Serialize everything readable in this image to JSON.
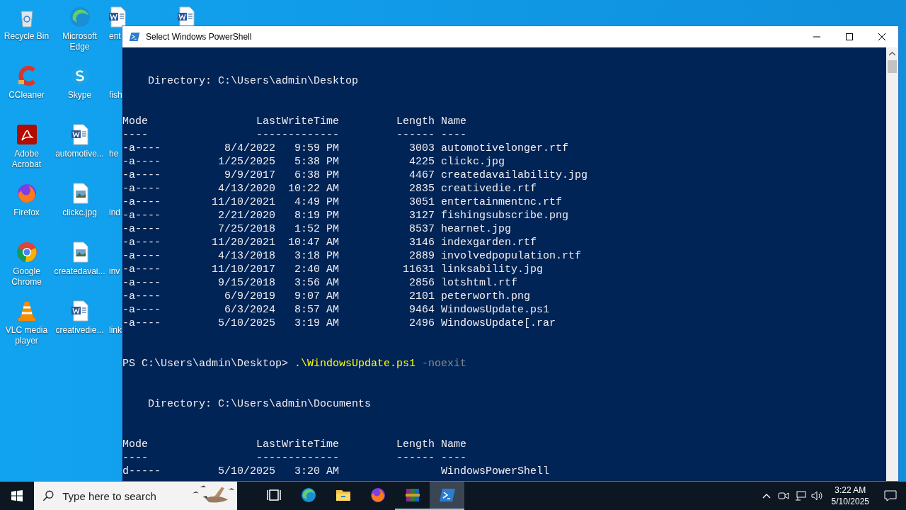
{
  "desktop_columns": [
    [
      {
        "kind": "bin",
        "label": "Recycle Bin"
      },
      {
        "kind": "ccleaner",
        "label": "CCleaner"
      },
      {
        "kind": "acrobat",
        "label": "Adobe Acrobat"
      },
      {
        "kind": "firefox",
        "label": "Firefox"
      },
      {
        "kind": "chrome",
        "label": "Google Chrome"
      },
      {
        "kind": "vlc",
        "label": "VLC media player"
      }
    ],
    [
      {
        "kind": "edge",
        "label": "Microsoft Edge"
      },
      {
        "kind": "skype",
        "label": "Skype"
      },
      {
        "kind": "word",
        "label": "automotive..."
      },
      {
        "kind": "image",
        "label": "clickc.jpg"
      },
      {
        "kind": "image",
        "label": "createdavai..."
      },
      {
        "kind": "word",
        "label": "creativedie..."
      }
    ],
    [
      {
        "kind": "word",
        "label": "ent"
      },
      {
        "kind": "hidden",
        "label": "fish"
      },
      {
        "kind": "hidden",
        "label": "he"
      },
      {
        "kind": "hidden",
        "label": "ind"
      },
      {
        "kind": "hidden",
        "label": "inv"
      },
      {
        "kind": "hidden",
        "label": "link"
      }
    ],
    [
      {
        "kind": "word"
      }
    ]
  ],
  "window": {
    "title": "Select Windows PowerShell"
  },
  "console": [
    {
      "kind": "blank"
    },
    {
      "kind": "blank"
    },
    {
      "kind": "directory",
      "text": "Directory: C:\\Users\\admin\\Desktop"
    },
    {
      "kind": "blank"
    },
    {
      "kind": "blank"
    },
    {
      "kind": "header",
      "mode": "Mode",
      "time": "LastWriteTime",
      "length": "Length",
      "name": "Name"
    },
    {
      "kind": "header",
      "mode": "----",
      "time": "-------------",
      "length": "------",
      "name": "----"
    },
    {
      "kind": "row",
      "mode": "-a----",
      "date": "8/4/2022",
      "time": "9:59 PM",
      "length": "3003",
      "name": "automotivelonger.rtf"
    },
    {
      "kind": "row",
      "mode": "-a----",
      "date": "1/25/2025",
      "time": "5:38 PM",
      "length": "4225",
      "name": "clickc.jpg"
    },
    {
      "kind": "row",
      "mode": "-a----",
      "date": "9/9/2017",
      "time": "6:38 PM",
      "length": "4467",
      "name": "createdavailability.jpg"
    },
    {
      "kind": "row",
      "mode": "-a----",
      "date": "4/13/2020",
      "time": "10:22 AM",
      "length": "2835",
      "name": "creativedie.rtf"
    },
    {
      "kind": "row",
      "mode": "-a----",
      "date": "11/10/2021",
      "time": "4:49 PM",
      "length": "3051",
      "name": "entertainmentnc.rtf"
    },
    {
      "kind": "row",
      "mode": "-a----",
      "date": "2/21/2020",
      "time": "8:19 PM",
      "length": "3127",
      "name": "fishingsubscribe.png"
    },
    {
      "kind": "row",
      "mode": "-a----",
      "date": "7/25/2018",
      "time": "1:52 PM",
      "length": "8537",
      "name": "hearnet.jpg"
    },
    {
      "kind": "row",
      "mode": "-a----",
      "date": "11/20/2021",
      "time": "10:47 AM",
      "length": "3146",
      "name": "indexgarden.rtf"
    },
    {
      "kind": "row",
      "mode": "-a----",
      "date": "4/13/2018",
      "time": "3:18 PM",
      "length": "2889",
      "name": "involvedpopulation.rtf"
    },
    {
      "kind": "row",
      "mode": "-a----",
      "date": "11/10/2017",
      "time": "2:40 AM",
      "length": "11631",
      "name": "linksability.jpg"
    },
    {
      "kind": "row",
      "mode": "-a----",
      "date": "9/15/2018",
      "time": "3:56 AM",
      "length": "2856",
      "name": "lotshtml.rtf"
    },
    {
      "kind": "row",
      "mode": "-a----",
      "date": "6/9/2019",
      "time": "9:07 AM",
      "length": "2101",
      "name": "peterworth.png"
    },
    {
      "kind": "row",
      "mode": "-a----",
      "date": "6/3/2024",
      "time": "8:57 AM",
      "length": "9464",
      "name": "WindowsUpdate.ps1"
    },
    {
      "kind": "row",
      "mode": "-a----",
      "date": "5/10/2025",
      "time": "3:19 AM",
      "length": "2496",
      "name": "WindowsUpdate[.rar"
    },
    {
      "kind": "blank"
    },
    {
      "kind": "blank"
    },
    {
      "kind": "prompt",
      "prompt": "PS C:\\Users\\admin\\Desktop>",
      "command": ".\\WindowsUpdate.ps1",
      "argument": "-noexit"
    },
    {
      "kind": "blank"
    },
    {
      "kind": "blank"
    },
    {
      "kind": "directory",
      "text": "Directory: C:\\Users\\admin\\Documents"
    },
    {
      "kind": "blank"
    },
    {
      "kind": "blank"
    },
    {
      "kind": "header",
      "mode": "Mode",
      "time": "LastWriteTime",
      "length": "Length",
      "name": "Name"
    },
    {
      "kind": "header",
      "mode": "----",
      "time": "-------------",
      "length": "------",
      "name": "----"
    },
    {
      "kind": "row",
      "mode": "d-----",
      "date": "5/10/2025",
      "time": "3:20 AM",
      "name": "WindowsPowerShell"
    }
  ],
  "taskbar": {
    "search": {
      "placeholder": "Type here to search"
    },
    "apps": [
      {
        "kind": "taskview",
        "running": false,
        "active": false
      },
      {
        "kind": "edge",
        "running": false,
        "active": false
      },
      {
        "kind": "explorer",
        "running": false,
        "active": false
      },
      {
        "kind": "firefox",
        "running": false,
        "active": false
      },
      {
        "kind": "winrar",
        "running": true,
        "active": false
      },
      {
        "kind": "powershell",
        "running": true,
        "active": true
      }
    ],
    "clock": {
      "time": "3:22 AM",
      "date": "5/10/2025"
    }
  }
}
